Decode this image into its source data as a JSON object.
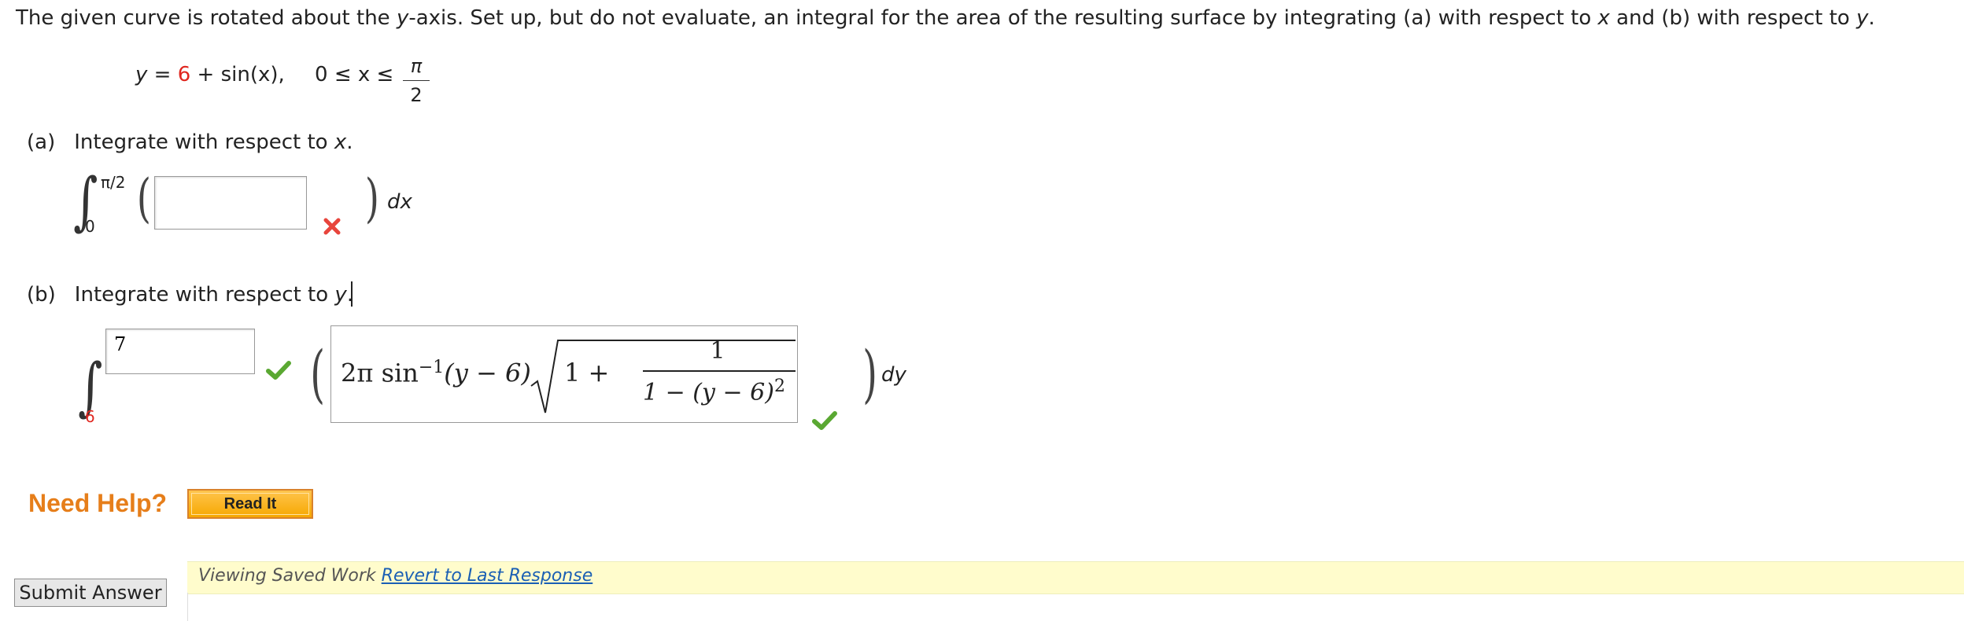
{
  "question": {
    "text_1": "The given curve is rotated about the ",
    "y_axis_var": "y",
    "text_2": "-axis. Set up, but do not evaluate, an integral for the area of the resulting surface by integrating (a) with respect to ",
    "x_var": "x",
    "text_3": " and (b) with respect to ",
    "y_var": "y",
    "text_4": "."
  },
  "equation": {
    "lhs": "y",
    "equals": " = ",
    "constant": "6",
    "rhs": " + sin(x),",
    "domain": "0 ≤ x ≤",
    "frac_num": "π",
    "frac_den": "2"
  },
  "part_a": {
    "label": "(a)",
    "prompt": "Integrate with respect to ",
    "var": "x",
    "period": ".",
    "upper_limit": "π/2",
    "lower_limit": "0",
    "integrand_value": "",
    "differential": "dx",
    "status": "incorrect"
  },
  "part_b": {
    "label": "(b)",
    "prompt": "Integrate with respect to ",
    "var": "y",
    "period": ".",
    "upper_limit_value": "7",
    "upper_limit_status": "correct",
    "lower_limit": "6",
    "integrand": {
      "coef": "2π sin",
      "exp": "−1",
      "arg": "(y − 6)",
      "sqrt_one": "1 +",
      "frac_num": "1",
      "frac_den": "1 − (y − 6)",
      "den_exp": "2"
    },
    "integrand_status": "correct",
    "differential": "dy"
  },
  "help": {
    "label": "Need Help?",
    "read_it": "Read It"
  },
  "submit_label": "Submit Answer",
  "saved": {
    "text": "Viewing Saved Work ",
    "link": "Revert to Last Response"
  },
  "colors": {
    "red_number": "#e0261f",
    "check_green": "#5aa832",
    "x_red": "#e8453c",
    "help_orange": "#e67e1a",
    "saved_bg": "#fffccc",
    "link_blue": "#1a5fb4"
  }
}
